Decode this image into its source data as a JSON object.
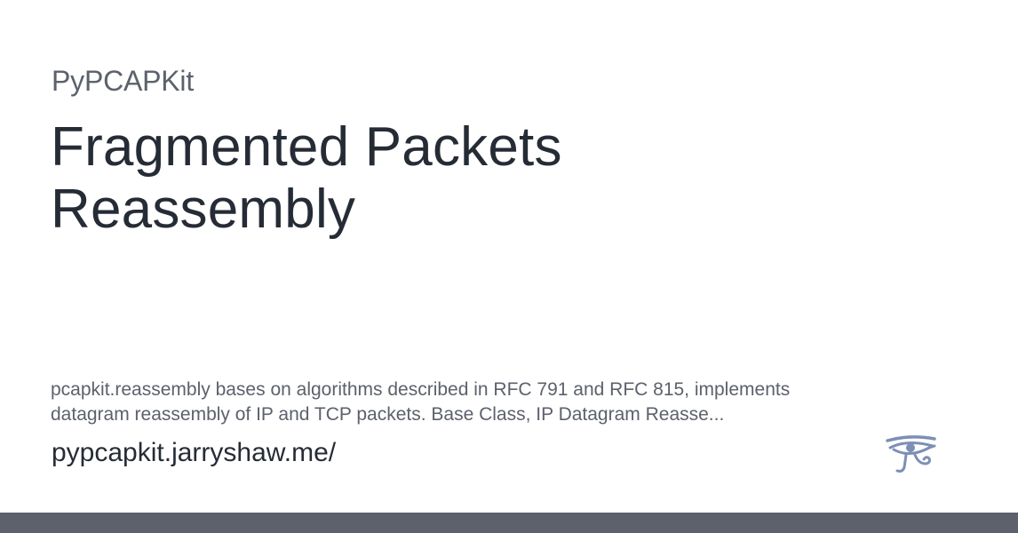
{
  "site": {
    "name": "PyPCAPKit",
    "url": "pypcapkit.jarryshaw.me/"
  },
  "page": {
    "title_line1": "Fragmented Packets",
    "title_line2": "Reassembly",
    "description_line1": "pcapkit.reassembly bases on algorithms described in RFC 791 and RFC 815, implements",
    "description_line2": "datagram reassembly of IP and TCP packets. Base Class, IP Datagram Reasse..."
  },
  "logo": {
    "icon": "eye-of-horus-icon",
    "color": "#7d8fb6"
  },
  "colors": {
    "background": "#ffffff",
    "title": "#262c36",
    "muted_text": "#5c616b",
    "bottom_bar": "#5c616b"
  }
}
